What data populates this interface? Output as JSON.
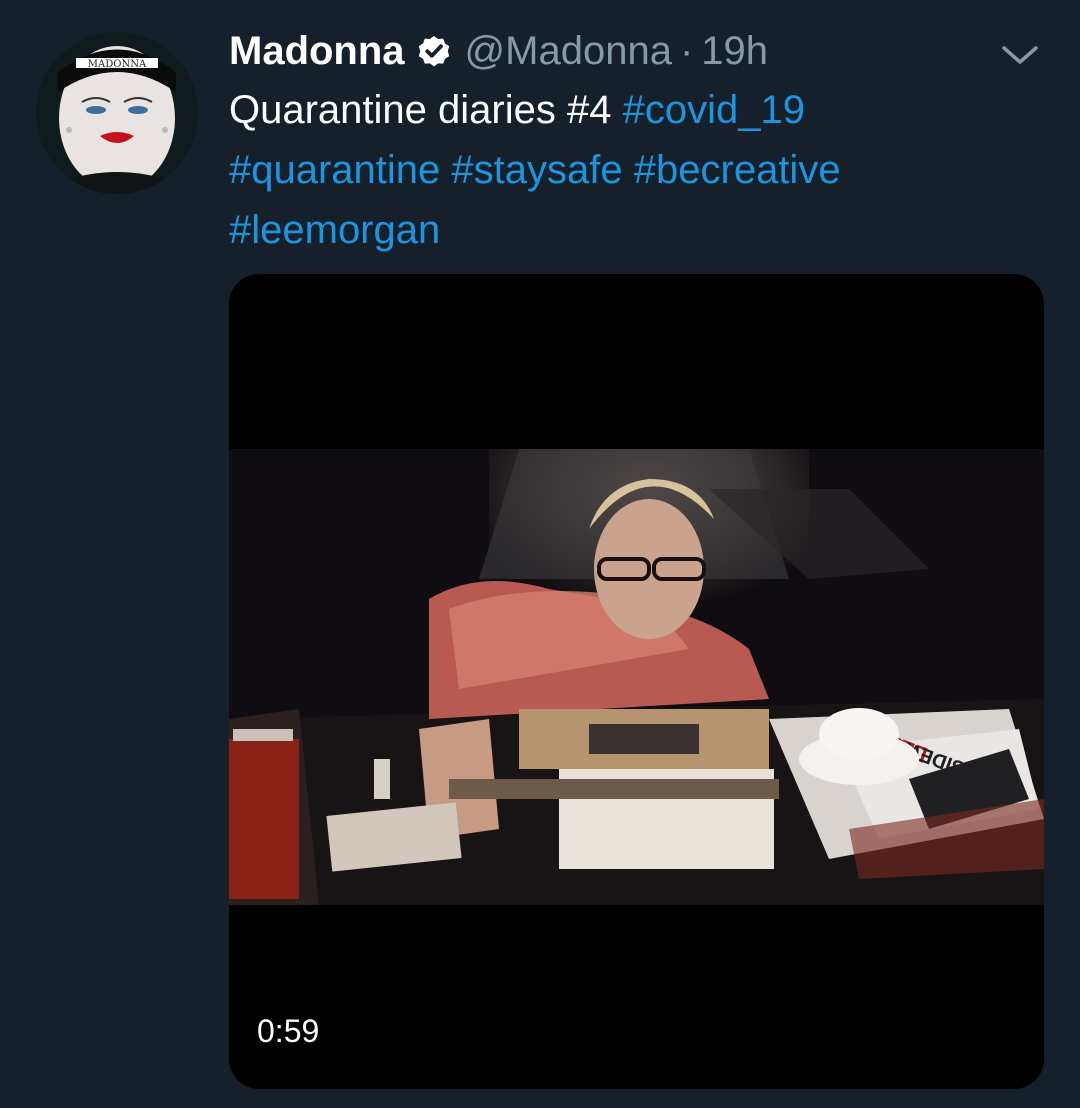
{
  "tweet": {
    "display_name": "Madonna",
    "handle": "@Madonna",
    "separator": "·",
    "time": "19h",
    "text_plain": "Quarantine diaries #4 ",
    "hashtags": [
      "#covid_19",
      "#quarantine",
      "#staysafe",
      "#becreative",
      "#leemorgan"
    ],
    "avatar_text": "MADONNA",
    "verified_icon": "verified-badge-icon",
    "menu_icon": "chevron-down-icon"
  },
  "media": {
    "type": "video",
    "duration": "0:59",
    "prop_text": "LEE",
    "prop_text_2": "THE SIDEWINDER"
  },
  "colors": {
    "background": "#15202b",
    "text": "#ffffff",
    "muted": "#8899a6",
    "link": "#1b95e0",
    "media_bg": "#000000"
  }
}
